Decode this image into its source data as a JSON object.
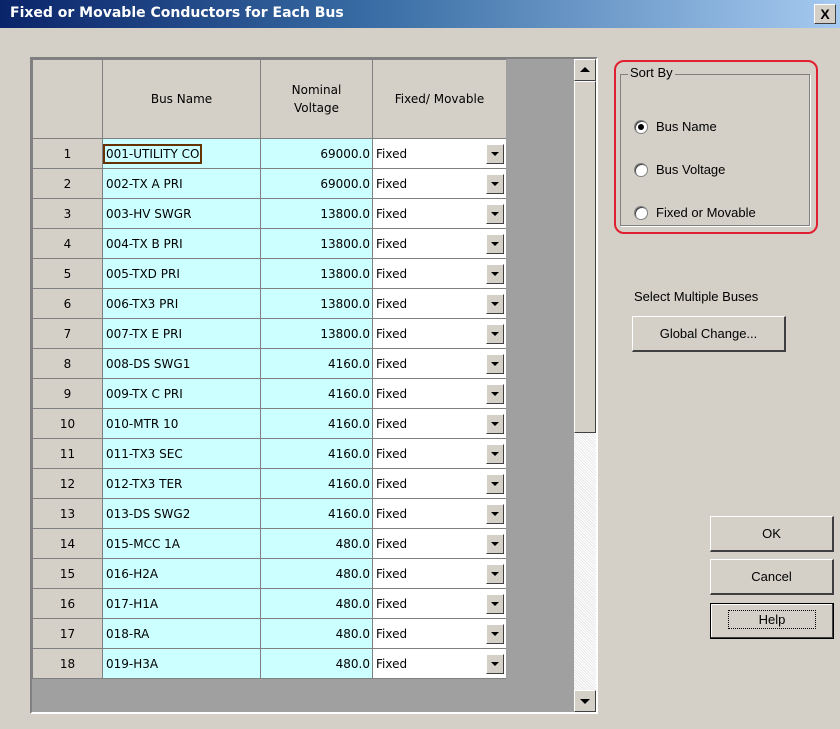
{
  "window": {
    "title": "Fixed or Movable Conductors for Each Bus",
    "close_label": "X"
  },
  "grid": {
    "columns": [
      "",
      "Bus Name",
      "Nominal\nVoltage",
      "Fixed/ Movable"
    ],
    "column_headers": {
      "rownum": "",
      "bus_name": "Bus Name",
      "voltage_line1": "Nominal",
      "voltage_line2": "Voltage",
      "fixed": "Fixed/ Movable"
    },
    "rows": [
      {
        "n": "1",
        "bus": "001-UTILITY CO",
        "voltage": "69000.0",
        "fixed": "Fixed"
      },
      {
        "n": "2",
        "bus": "002-TX A PRI",
        "voltage": "69000.0",
        "fixed": "Fixed"
      },
      {
        "n": "3",
        "bus": "003-HV SWGR",
        "voltage": "13800.0",
        "fixed": "Fixed"
      },
      {
        "n": "4",
        "bus": "004-TX B PRI",
        "voltage": "13800.0",
        "fixed": "Fixed"
      },
      {
        "n": "5",
        "bus": "005-TXD PRI",
        "voltage": "13800.0",
        "fixed": "Fixed"
      },
      {
        "n": "6",
        "bus": "006-TX3 PRI",
        "voltage": "13800.0",
        "fixed": "Fixed"
      },
      {
        "n": "7",
        "bus": "007-TX E PRI",
        "voltage": "13800.0",
        "fixed": "Fixed"
      },
      {
        "n": "8",
        "bus": "008-DS SWG1",
        "voltage": "4160.0",
        "fixed": "Fixed"
      },
      {
        "n": "9",
        "bus": "009-TX C PRI",
        "voltage": "4160.0",
        "fixed": "Fixed"
      },
      {
        "n": "10",
        "bus": "010-MTR 10",
        "voltage": "4160.0",
        "fixed": "Fixed"
      },
      {
        "n": "11",
        "bus": "011-TX3 SEC",
        "voltage": "4160.0",
        "fixed": "Fixed"
      },
      {
        "n": "12",
        "bus": "012-TX3 TER",
        "voltage": "4160.0",
        "fixed": "Fixed"
      },
      {
        "n": "13",
        "bus": "013-DS SWG2",
        "voltage": "4160.0",
        "fixed": "Fixed"
      },
      {
        "n": "14",
        "bus": "015-MCC 1A",
        "voltage": "480.0",
        "fixed": "Fixed"
      },
      {
        "n": "15",
        "bus": "016-H2A",
        "voltage": "480.0",
        "fixed": "Fixed"
      },
      {
        "n": "16",
        "bus": "017-H1A",
        "voltage": "480.0",
        "fixed": "Fixed"
      },
      {
        "n": "17",
        "bus": "018-RA",
        "voltage": "480.0",
        "fixed": "Fixed"
      },
      {
        "n": "18",
        "bus": "019-H3A",
        "voltage": "480.0",
        "fixed": "Fixed"
      }
    ],
    "selected_row": "1"
  },
  "sort_by": {
    "label": "Sort By",
    "options": [
      "Bus Name",
      "Bus Voltage",
      "Fixed or Movable"
    ],
    "selected": "Bus Name",
    "highlight_color": "#e02030"
  },
  "multi": {
    "label": "Select Multiple Buses",
    "button": "Global Change..."
  },
  "buttons": {
    "ok": "OK",
    "cancel": "Cancel",
    "help": "Help"
  },
  "colors": {
    "cell_background": "#ccffff",
    "dialog_background": "#d4d0c8"
  }
}
